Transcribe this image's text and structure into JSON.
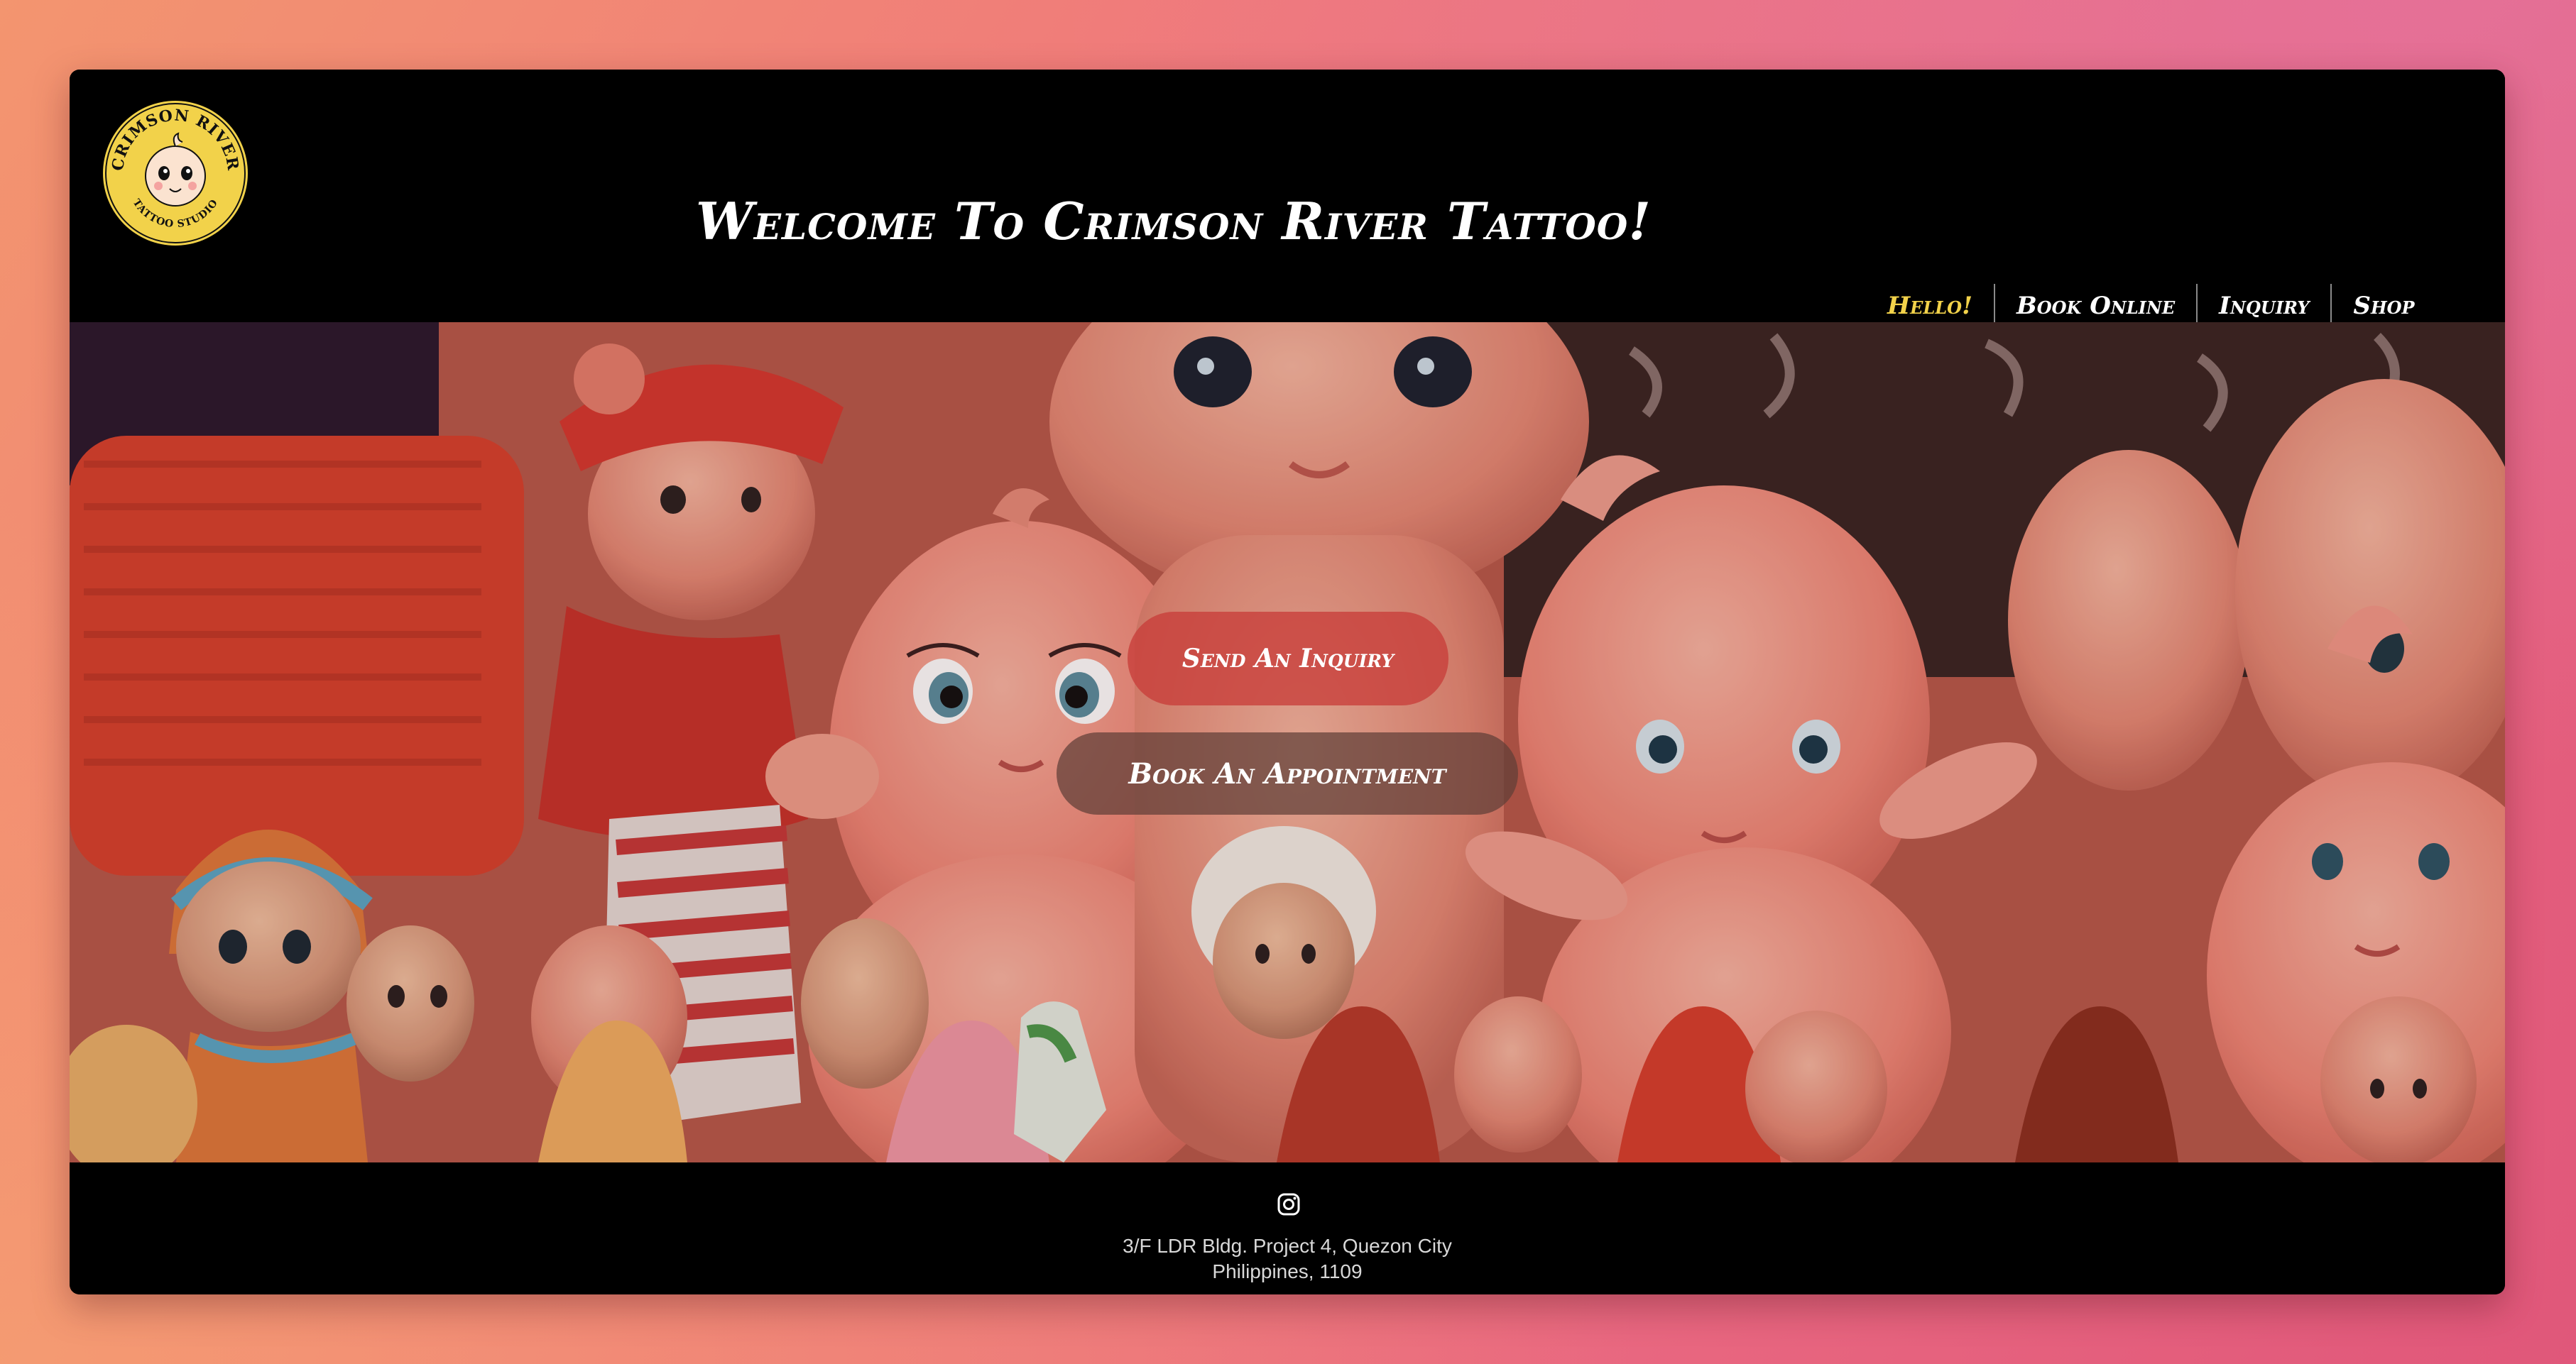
{
  "header": {
    "title": "Welcome To Crimson River Tattoo!",
    "logo": {
      "icon": "kewpie-logo-icon",
      "top_text": "CRIMSON RIVER",
      "bottom_text": "TATTOO STUDIO",
      "color": "#f2d24a"
    }
  },
  "nav": {
    "items": [
      {
        "label": "Hello!",
        "active": true
      },
      {
        "label": "Book Online",
        "active": false
      },
      {
        "label": "Inquiry",
        "active": false
      },
      {
        "label": "Shop",
        "active": false
      }
    ],
    "active_color": "#f2d24a"
  },
  "hero": {
    "image": "kewpie-dolls-photo",
    "buttons": {
      "inquiry_label": "Send An Inquiry",
      "book_label": "Book An Appointment"
    }
  },
  "footer": {
    "social_icon": "instagram-icon",
    "address_line1": "3/F LDR Bldg. Project 4, Quezon City",
    "address_line2": "Philippines, 1109"
  }
}
